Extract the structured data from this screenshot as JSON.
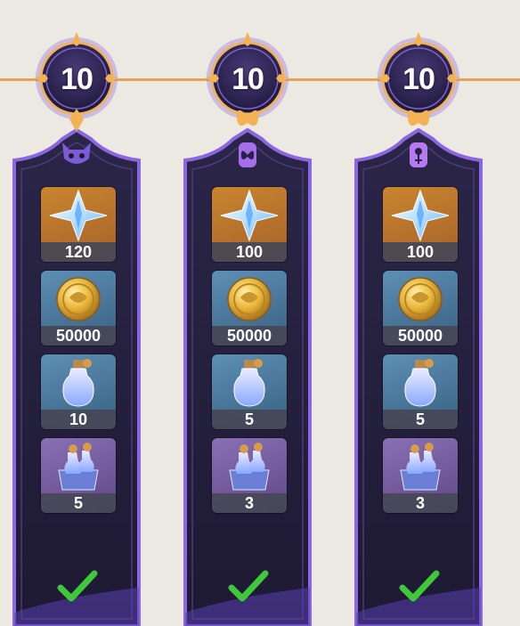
{
  "reward_track": {
    "columns": [
      {
        "tier_label": "10",
        "emblem": "cat-mask-icon",
        "rewards": [
          {
            "item": "primogem-icon",
            "count": "120"
          },
          {
            "item": "mora-coin-icon",
            "count": "50000"
          },
          {
            "item": "wanderers-advice-potion-icon",
            "count": "10"
          },
          {
            "item": "heros-wit-potion-icon",
            "count": "5"
          }
        ],
        "claimed": true
      },
      {
        "tier_label": "10",
        "emblem": "butterfly-icon",
        "rewards": [
          {
            "item": "primogem-icon",
            "count": "100"
          },
          {
            "item": "mora-coin-icon",
            "count": "50000"
          },
          {
            "item": "wanderers-advice-potion-icon",
            "count": "5"
          },
          {
            "item": "heros-wit-potion-icon",
            "count": "3"
          }
        ],
        "claimed": true
      },
      {
        "tier_label": "10",
        "emblem": "flower-icon",
        "rewards": [
          {
            "item": "primogem-icon",
            "count": "100"
          },
          {
            "item": "mora-coin-icon",
            "count": "50000"
          },
          {
            "item": "wanderers-advice-potion-icon",
            "count": "5"
          },
          {
            "item": "heros-wit-potion-icon",
            "count": "3"
          }
        ],
        "claimed": true
      }
    ]
  },
  "colors": {
    "frame_dark": "#26213f",
    "frame_glow": "#8a67e0",
    "track_orange": "#e6a25a",
    "check_green": "#3fc83a"
  }
}
